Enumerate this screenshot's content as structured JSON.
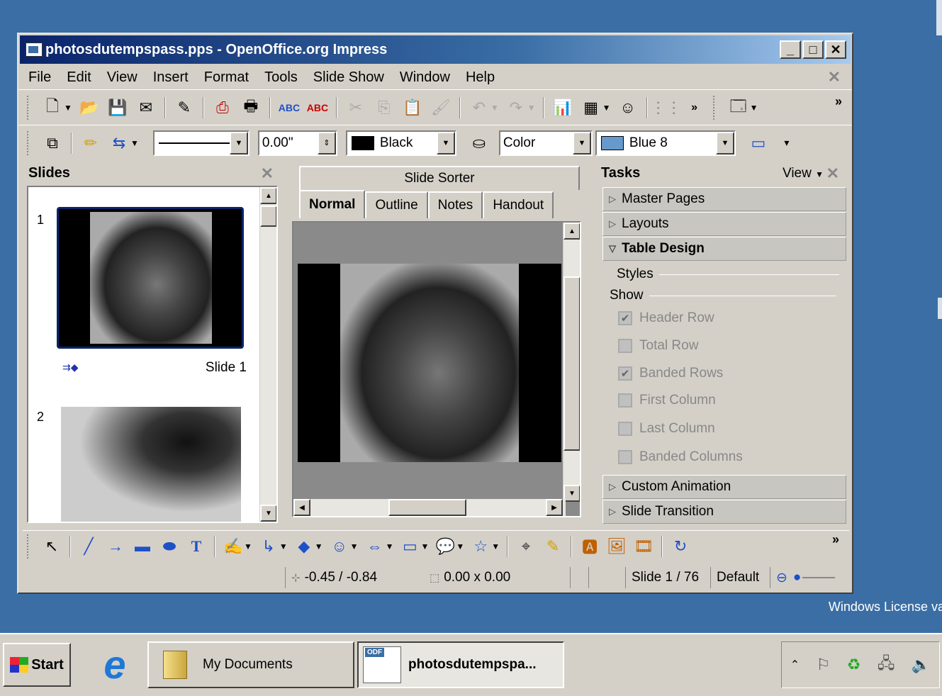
{
  "window": {
    "title": "photosdutempspass.pps - OpenOffice.org Impress",
    "controls": {
      "minimize": "_",
      "maximize": "□",
      "close": "✕"
    }
  },
  "menu": [
    "File",
    "Edit",
    "View",
    "Insert",
    "Format",
    "Tools",
    "Slide Show",
    "Window",
    "Help"
  ],
  "line_toolbar": {
    "line_width_value": "0.00\"",
    "line_color": "Black",
    "area_style": "Color",
    "area_color": "Blue 8",
    "area_color_hex": "#6699cc"
  },
  "slides_pane": {
    "title": "Slides",
    "slides": [
      {
        "number": "1",
        "label": "Slide 1"
      },
      {
        "number": "2",
        "label": ""
      }
    ]
  },
  "center": {
    "sorter_tab": "Slide Sorter",
    "tabs": [
      "Normal",
      "Outline",
      "Notes",
      "Handout"
    ],
    "active_tab": "Normal"
  },
  "tasks": {
    "title": "Tasks",
    "view_label": "View",
    "sections": {
      "master_pages": "Master Pages",
      "layouts": "Layouts",
      "table_design": "Table Design",
      "custom_animation": "Custom Animation",
      "slide_transition": "Slide Transition"
    },
    "styles_label": "Styles",
    "show_label": "Show",
    "options": [
      {
        "label": "Header Row",
        "checked": true
      },
      {
        "label": "Total Row",
        "checked": false
      },
      {
        "label": "Banded Rows",
        "checked": true
      },
      {
        "label": "First Column",
        "checked": false
      },
      {
        "label": "Last Column",
        "checked": false
      },
      {
        "label": "Banded Columns",
        "checked": false
      }
    ]
  },
  "status": {
    "position": "-0.45 / -0.84",
    "size": "0.00 x 0.00",
    "slide": "Slide 1 / 76",
    "layout": "Default"
  },
  "desktop": {
    "license_text": "Windows License va"
  },
  "taskbar": {
    "start": "Start",
    "items": [
      "My Documents",
      "photosdutempspa..."
    ]
  }
}
